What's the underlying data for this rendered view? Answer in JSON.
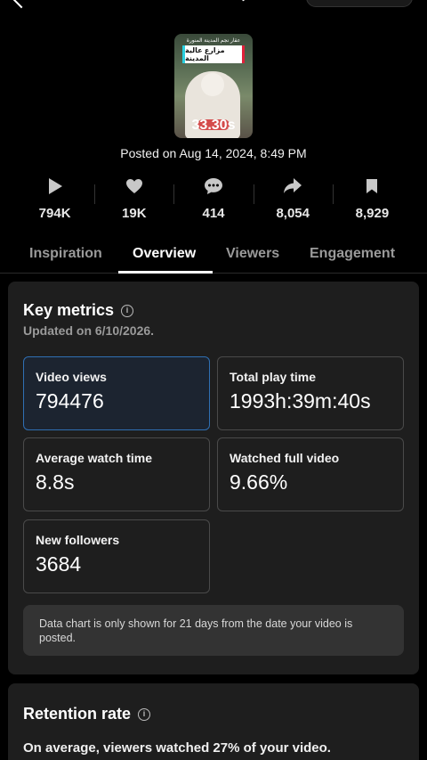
{
  "video": {
    "thumbnail_top_text": "عقار نجم المدينة المنورة",
    "thumbnail_banner": "مزارع عالية المدينة",
    "duration": "33.30s",
    "posted": "Posted on Aug 14, 2024, 8:49 PM"
  },
  "stats": [
    {
      "icon": "play-icon",
      "value": "794K"
    },
    {
      "icon": "heart-icon",
      "value": "19K"
    },
    {
      "icon": "comment-icon",
      "value": "414"
    },
    {
      "icon": "share-icon",
      "value": "8,054"
    },
    {
      "icon": "bookmark-icon",
      "value": "8,929"
    }
  ],
  "tabs": [
    "Inspiration",
    "Overview",
    "Viewers",
    "Engagement"
  ],
  "active_tab": "Overview",
  "key_metrics": {
    "title": "Key metrics",
    "updated": "Updated on 6/10/2026.",
    "items": [
      {
        "label": "Video views",
        "value": "794476"
      },
      {
        "label": "Total play time",
        "value": "1993h:39m:40s"
      },
      {
        "label": "Average watch time",
        "value": "8.8s"
      },
      {
        "label": "Watched full video",
        "value": "9.66%"
      },
      {
        "label": "New followers",
        "value": "3684"
      }
    ],
    "note": "Data chart is only shown for 21 days from the date your video is posted."
  },
  "retention": {
    "title": "Retention rate",
    "subtitle": "On average, viewers watched 27% of your video."
  },
  "colors": {
    "background": "#000000",
    "card": "#1e1e1e",
    "selected_border": "#2f6fb3"
  }
}
